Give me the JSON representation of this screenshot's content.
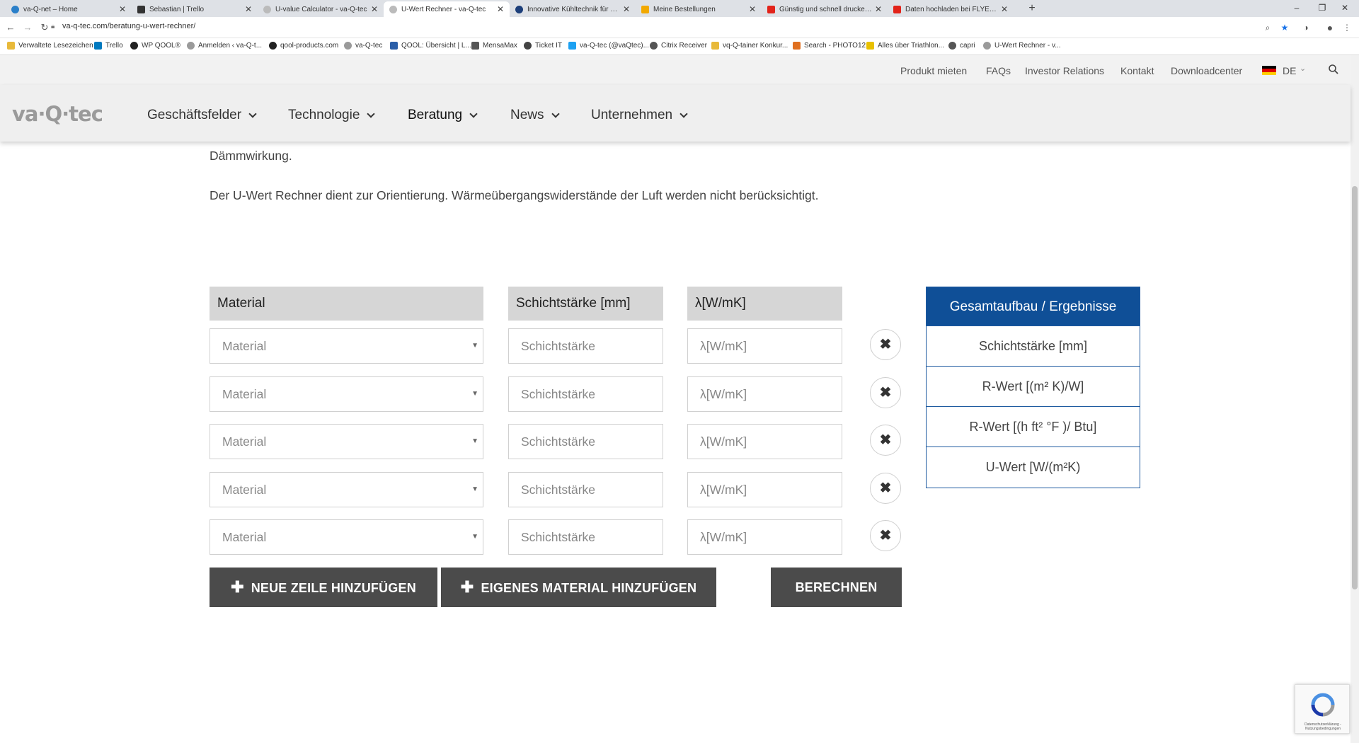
{
  "browser": {
    "tabs": [
      {
        "label": "va-Q-net – Home",
        "color": "#2a7fc9"
      },
      {
        "label": "Sebastian | Trello",
        "color": "#333333"
      },
      {
        "label": "U-value Calculator - va-Q-tec",
        "color": "#9a9a9a"
      },
      {
        "label": "U-Wert Rechner - va-Q-tec",
        "color": "#9a9a9a"
      },
      {
        "label": "Innovative Kühltechnik für den A",
        "color": "#1d3f7a"
      },
      {
        "label": "Meine Bestellungen",
        "color": "#f2a900"
      },
      {
        "label": "Günstig und schnell drucken bei",
        "color": "#e2231a"
      },
      {
        "label": "Daten hochladen bei FLYERALAR",
        "color": "#e2231a"
      }
    ],
    "url": "va-q-tec.com/beratung-u-wert-rechner/",
    "bookmarks": [
      {
        "label": "Verwaltete Lesezeichen",
        "color": "#e8b93a"
      },
      {
        "label": "Trello",
        "color": "#0079bf"
      },
      {
        "label": "WP QOOL®",
        "color": "#222222"
      },
      {
        "label": "Anmelden ‹ va-Q-t...",
        "color": "#9a9a9a"
      },
      {
        "label": "qool-products.com",
        "color": "#222222"
      },
      {
        "label": "va-Q-tec",
        "color": "#9a9a9a"
      },
      {
        "label": "QOOL: Übersicht | L...",
        "color": "#2a5ea8"
      },
      {
        "label": "MensaMax",
        "color": "#555555"
      },
      {
        "label": "Ticket IT",
        "color": "#444444"
      },
      {
        "label": "va-Q-tec (@vaQtec)...",
        "color": "#1da1f2"
      },
      {
        "label": "Citrix Receiver",
        "color": "#555555"
      },
      {
        "label": "vq-Q-tainer Konkur...",
        "color": "#e8b93a"
      },
      {
        "label": "Search - PHOTO12",
        "color": "#e07020"
      },
      {
        "label": "Alles über Triathlon...",
        "color": "#e8c000"
      },
      {
        "label": "capri",
        "color": "#555555"
      },
      {
        "label": "U-Wert Rechner - v...",
        "color": "#9a9a9a"
      }
    ]
  },
  "header": {
    "top_links": [
      "Produkt mieten",
      "FAQs",
      "Investor Relations",
      "Kontakt",
      "Downloadcenter"
    ],
    "language": "DE",
    "logo_text": "va·Q·tec",
    "nav": [
      "Geschäftsfelder",
      "Technologie",
      "Beratung",
      "News",
      "Unternehmen"
    ]
  },
  "content": {
    "intro_tail": "Dämmwirkung.",
    "note": "Der U-Wert Rechner dient zur Orientierung. Wärmeübergangswiderstände der Luft werden nicht berücksichtigt.",
    "columns": {
      "material": "Material",
      "thickness": "Schichtstärke [mm]",
      "lambda": "λ[W/mK]"
    },
    "rows": [
      {
        "material_placeholder": "Material",
        "thickness_placeholder": "Schichtstärke",
        "lambda_placeholder": "λ[W/mK]"
      },
      {
        "material_placeholder": "Material",
        "thickness_placeholder": "Schichtstärke",
        "lambda_placeholder": "λ[W/mK]"
      },
      {
        "material_placeholder": "Material",
        "thickness_placeholder": "Schichtstärke",
        "lambda_placeholder": "λ[W/mK]"
      },
      {
        "material_placeholder": "Material",
        "thickness_placeholder": "Schichtstärke",
        "lambda_placeholder": "λ[W/mK]"
      },
      {
        "material_placeholder": "Material",
        "thickness_placeholder": "Schichtstärke",
        "lambda_placeholder": "λ[W/mK]"
      }
    ],
    "buttons": {
      "add_row": "NEUE ZEILE HINZUFÜGEN",
      "add_material": "EIGENES MATERIAL HINZUFÜGEN",
      "calculate": "BERECHNEN"
    },
    "results": {
      "title": "Gesamtaufbau / Ergebnisse",
      "rows": [
        "Schichtstärke [mm]",
        "R-Wert [(m² K)/W]",
        "R-Wert [(h ft² °F )/ Btu]",
        "U-Wert [W/(m²K)"
      ]
    },
    "recaptcha_text": "Datenschutzerklärung - Nutzungsbedingungen"
  },
  "colors": {
    "accent_blue": "#0f4f97",
    "button_dark": "#4b4b4b",
    "header_gray": "#d6d6d6"
  }
}
